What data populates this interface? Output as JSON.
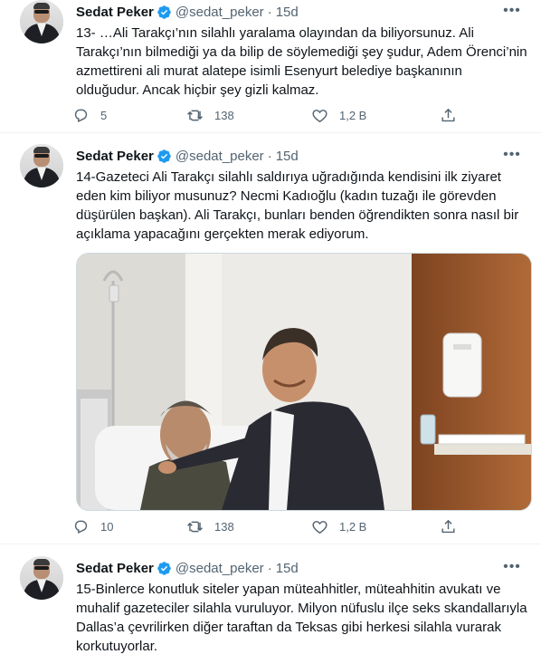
{
  "tweets": [
    {
      "author_name": "Sedat Peker",
      "handle": "@sedat_peker",
      "separator": "·",
      "time": "15d",
      "text": "13- …Ali Tarakçı’nın silahlı yaralama olayından da biliyorsunuz. Ali Tarakçı’nın bilmediği ya da bilip de söylemediği şey şudur, Adem Örenci’nin azmettireni ali murat alatepe isimli Esenyurt belediye başkanının olduğudur. Ancak hiçbir şey gizli kalmaz.",
      "replies": "5",
      "retweets": "138",
      "likes": "1,2 B"
    },
    {
      "author_name": "Sedat Peker",
      "handle": "@sedat_peker",
      "separator": "·",
      "time": "15d",
      "text": "14-Gazeteci Ali Tarakçı silahlı saldırıya uğradığında kendisini ilk ziyaret eden kim biliyor musunuz? Necmi Kadıoğlu (kadın tuzağı ile görevden düşürülen başkan). Ali Tarakçı, bunları benden öğrendikten sonra nasıl bir açıklama yapacağını gerçekten merak ediyorum.",
      "replies": "10",
      "retweets": "138",
      "likes": "1,2 B"
    },
    {
      "author_name": "Sedat Peker",
      "handle": "@sedat_peker",
      "separator": "·",
      "time": "15d",
      "text": "15-Binlerce konutluk siteler yapan müteahhitler, müteahhitin avukatı ve muhalif gazeteciler silahla vuruluyor. Milyon nüfuslu ilçe seks skandallarıyla Dallas’a çevrilirken diğer taraftan da Teksas gibi herkesi silahla vurarak korkutuyorlar."
    }
  ],
  "colors": {
    "text": "#0f1419",
    "secondary": "#536471",
    "verified": "#1d9bf0",
    "separator": "#eff3f4"
  },
  "icons": [
    "verified-badge-icon",
    "more-icon",
    "reply-icon",
    "retweet-icon",
    "like-icon",
    "share-icon"
  ]
}
